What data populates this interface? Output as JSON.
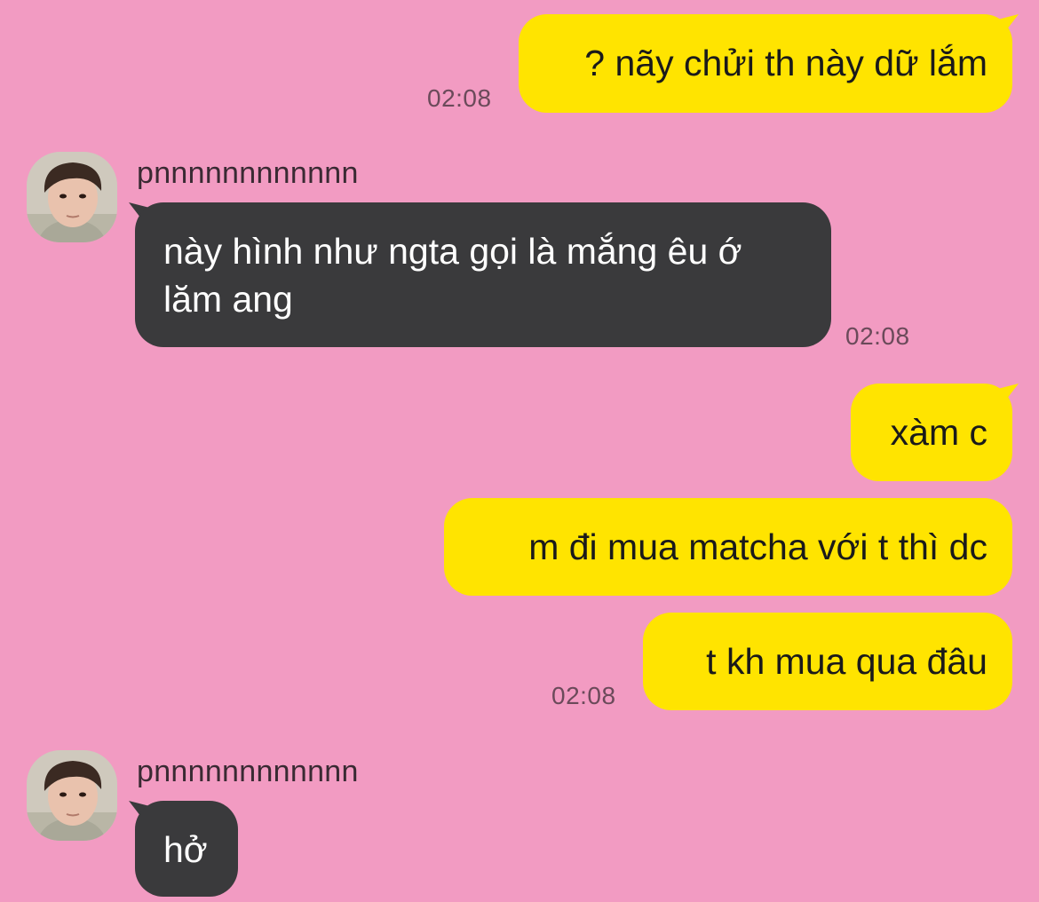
{
  "colors": {
    "background": "#f29bc2",
    "outgoing_bubble": "#ffe400",
    "incoming_bubble": "#3a3a3c",
    "incoming_text": "#ffffff",
    "outgoing_text": "#1a1a1a",
    "timestamp": "#6b4a5a"
  },
  "messages": [
    {
      "direction": "outgoing",
      "text": "? nãy chửi th này dữ lắm",
      "time": "02:08"
    },
    {
      "direction": "incoming",
      "sender": "pnnnnnnnnnnnn",
      "avatar_icon": "user-avatar-icon",
      "text": "này hình như ngta gọi là mắng êu ớ lăm ang",
      "time": "02:08"
    },
    {
      "direction": "outgoing",
      "text": "xàm c"
    },
    {
      "direction": "outgoing",
      "text": "m đi mua matcha với t thì dc"
    },
    {
      "direction": "outgoing",
      "text": "t kh mua qua đâu",
      "time": "02:08"
    },
    {
      "direction": "incoming",
      "sender": "pnnnnnnnnnnnn",
      "avatar_icon": "user-avatar-icon",
      "text": "hở"
    }
  ]
}
